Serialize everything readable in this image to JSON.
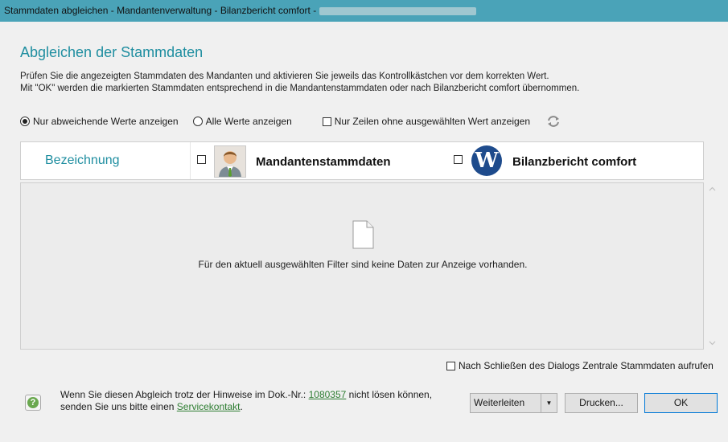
{
  "window": {
    "title": "Stammdaten abgleichen - Mandantenverwaltung - Bilanzbericht comfort -"
  },
  "heading": "Abgleichen der Stammdaten",
  "description": {
    "line1": "Prüfen Sie die angezeigten Stammdaten des Mandanten und aktivieren Sie jeweils das Kontrollkästchen vor dem korrekten Wert.",
    "line2": "Mit \"OK\" werden die markierten Stammdaten entsprechend in die Mandantenstammdaten oder nach Bilanzbericht comfort übernommen."
  },
  "filters": {
    "radio_diff": "Nur abweichende Werte anzeigen",
    "radio_all": "Alle Werte anzeigen",
    "check_unselected": "Nur Zeilen ohne ausgewählten Wert anzeigen",
    "selected": "radio_diff"
  },
  "grid": {
    "col_label": "Bezeichnung",
    "col_mandant": "Mandantenstammdaten",
    "col_bilanz": "Bilanzbericht comfort",
    "bilanz_logo_letter": "W",
    "empty_message": "Für den aktuell ausgewählten Filter sind keine Daten zur Anzeige vorhanden."
  },
  "after_close_label": "Nach Schließen des Dialogs Zentrale Stammdaten aufrufen",
  "hint": {
    "line1_pre": "Wenn Sie diesen Abgleich trotz der Hinweise im Dok.-Nr.:",
    "doc_number": "1080357",
    "line1_post": "nicht lösen können,",
    "line2_pre": "senden Sie uns bitte einen",
    "service_link": "Servicekontakt",
    "line2_post": "."
  },
  "help_symbol": "?",
  "buttons": {
    "forward": "Weiterleiten",
    "print": "Drucken...",
    "ok": "OK"
  },
  "colors": {
    "titlebar": "#4aa3b8",
    "accent": "#1f8ea0",
    "link": "#2e7d32",
    "primary_border": "#0078d7"
  }
}
